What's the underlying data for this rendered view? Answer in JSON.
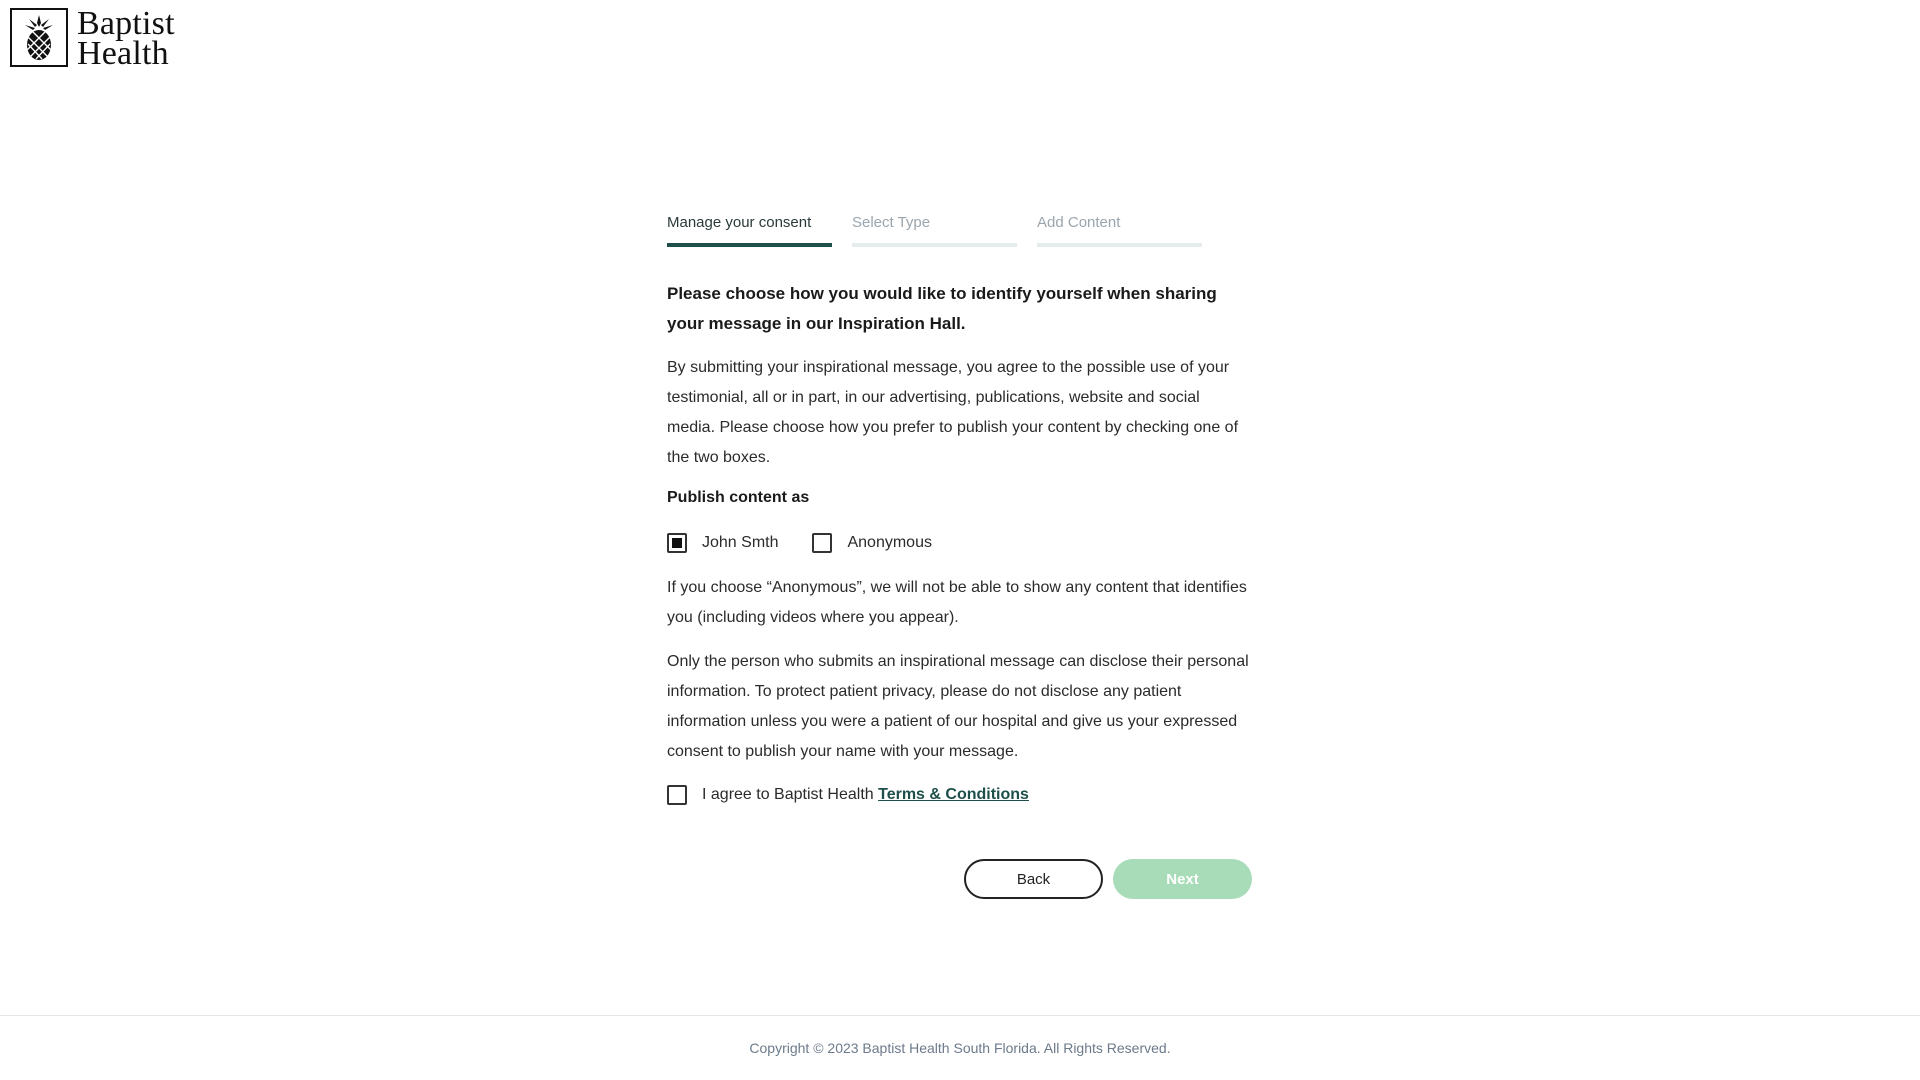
{
  "logo": {
    "line1": "Baptist",
    "line2": "Health",
    "icon": "pineapple-icon"
  },
  "steps": [
    {
      "label": "Manage your consent",
      "active": true
    },
    {
      "label": "Select Type",
      "active": false
    },
    {
      "label": "Add Content",
      "active": false
    }
  ],
  "content": {
    "heading": "Please choose how you would like to identify yourself when sharing your message in our Inspiration Hall.",
    "intro": "By submitting your inspirational message, you agree to the possible use of your testimonial, all or in part, in our advertising, publications, website and social media. Please choose how you prefer to publish your content by checking one of the two boxes.",
    "publish_heading": "Publish content as",
    "option_name": "John Smth",
    "option_name_checked": true,
    "option_anonymous": "Anonymous",
    "option_anonymous_checked": false,
    "anonymous_note": "If you choose “Anonymous”, we will not be able to show any content that identifies you (including videos where you appear).",
    "privacy_note": "Only the person who submits an inspirational message can disclose their personal information. To protect patient privacy, please do not disclose any patient information unless you were a patient of our hospital and give us your expressed consent to publish your name with your message.",
    "agree_text": "I agree to Baptist Health ",
    "terms_link": "Terms & Conditions",
    "agree_checked": false
  },
  "buttons": {
    "back": "Back",
    "next": "Next"
  },
  "footer": {
    "copyright": "Copyright © 2023 Baptist Health South Florida. All Rights Reserved."
  },
  "colors": {
    "accent": "#1e4f4a",
    "next_disabled": "#a8dcb8",
    "step_inactive": "#e6ebee"
  }
}
